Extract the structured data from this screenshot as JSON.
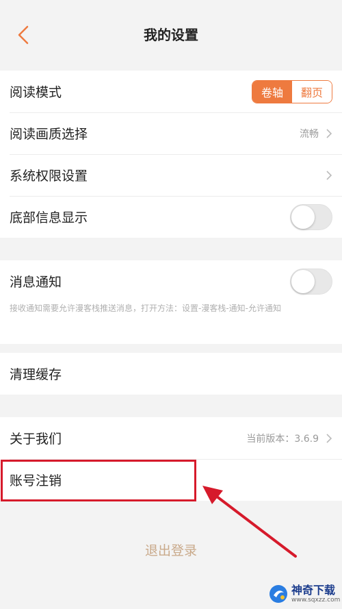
{
  "header": {
    "title": "我的设置"
  },
  "group1": {
    "items": [
      {
        "label": "阅读模式",
        "segments": [
          "卷轴",
          "翻页"
        ],
        "selected": "卷轴"
      },
      {
        "label": "阅读画质选择",
        "value": "流畅"
      },
      {
        "label": "系统权限设置"
      },
      {
        "label": "底部信息显示",
        "toggle": false
      }
    ]
  },
  "group2": {
    "items": [
      {
        "label": "消息通知",
        "toggle": false
      }
    ],
    "notice": "接收通知需要允许漫客栈推送消息，打开方法：设置-漫客栈-通知-允许通知"
  },
  "group3": {
    "items": [
      {
        "label": "清理缓存"
      }
    ]
  },
  "group4": {
    "items": [
      {
        "label": "关于我们",
        "value": "当前版本：3.6.9"
      },
      {
        "label": "账号注销"
      }
    ]
  },
  "logout": {
    "label": "退出登录"
  },
  "watermark": {
    "title": "神奇下载",
    "url": "www.sqxzz.com"
  },
  "colors": {
    "accent": "#ee7a3f",
    "annotation": "#d61a2b"
  }
}
